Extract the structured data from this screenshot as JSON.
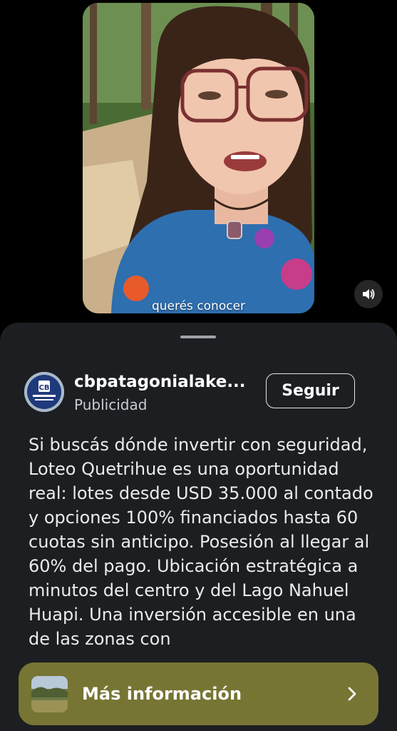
{
  "video": {
    "caption": "querés conocer",
    "sound_icon": "speaker-icon"
  },
  "sheet": {
    "account": {
      "name": "cbpatagonialake...",
      "subtitle": "Publicidad",
      "avatar_icon": "coldwell-banker-logo"
    },
    "follow_label": "Seguir",
    "ad_text": "Si buscás dónde invertir con seguridad, Loteo Quetrihue es una oportunidad real: lotes desde USD 35.000 al contado y opciones 100% financiados hasta 60 cuotas sin anticipo. Posesión al llegar al 60% del pago. Ubicación estratégica a minutos del centro y del Lago Nahuel Huapi. Una inversión accesible en una de las zonas con"
  },
  "cta": {
    "label": "Más información",
    "chevron_icon": "chevron-right-icon"
  },
  "colors": {
    "sheet_bg": "#1c1e21",
    "cta_bg": "#767533",
    "text": "#ffffff"
  }
}
